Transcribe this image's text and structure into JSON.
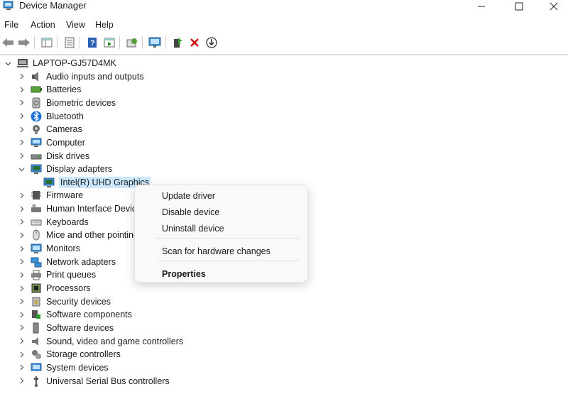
{
  "window": {
    "title": "Device Manager",
    "app_icon": "device-manager-icon",
    "controls": [
      "minimize-icon",
      "maximize-icon",
      "close-icon"
    ]
  },
  "menu": [
    "File",
    "Action",
    "View",
    "Help"
  ],
  "toolbar": [
    "back-arrow-icon",
    "forward-arrow-icon",
    "show-hide-tree-icon",
    "properties-icon",
    "help-icon",
    "action-pane-icon",
    "scan-changes-icon",
    "monitor-icon",
    "update-driver-icon",
    "uninstall-x-icon",
    "disable-device-icon"
  ],
  "tree": {
    "root": "LAPTOP-GJ57D4MK",
    "categories": [
      {
        "label": "Audio inputs and outputs",
        "icon": "speaker-icon"
      },
      {
        "label": "Batteries",
        "icon": "battery-icon"
      },
      {
        "label": "Biometric devices",
        "icon": "fingerprint-icon"
      },
      {
        "label": "Bluetooth",
        "icon": "bluetooth-icon"
      },
      {
        "label": "Cameras",
        "icon": "camera-icon"
      },
      {
        "label": "Computer",
        "icon": "computer-icon"
      },
      {
        "label": "Disk drives",
        "icon": "disk-drive-icon"
      },
      {
        "label": "Display adapters",
        "icon": "display-adapter-icon",
        "expanded": true,
        "children": [
          {
            "label": "Intel(R) UHD Graphics",
            "icon": "display-adapter-icon",
            "selected": true
          }
        ]
      },
      {
        "label": "Firmware",
        "icon": "firmware-icon"
      },
      {
        "label": "Human Interface Devices",
        "icon": "hid-icon"
      },
      {
        "label": "Keyboards",
        "icon": "keyboard-icon"
      },
      {
        "label": "Mice and other pointing devices",
        "icon": "mouse-icon"
      },
      {
        "label": "Monitors",
        "icon": "monitor-icon"
      },
      {
        "label": "Network adapters",
        "icon": "network-adapter-icon"
      },
      {
        "label": "Print queues",
        "icon": "printer-icon"
      },
      {
        "label": "Processors",
        "icon": "processor-icon"
      },
      {
        "label": "Security devices",
        "icon": "security-device-icon"
      },
      {
        "label": "Software components",
        "icon": "software-component-icon"
      },
      {
        "label": "Software devices",
        "icon": "software-device-icon"
      },
      {
        "label": "Sound, video and game controllers",
        "icon": "sound-controller-icon"
      },
      {
        "label": "Storage controllers",
        "icon": "storage-controller-icon"
      },
      {
        "label": "System devices",
        "icon": "system-device-icon"
      },
      {
        "label": "Universal Serial Bus controllers",
        "icon": "usb-icon"
      }
    ]
  },
  "context_menu": {
    "items": [
      "Update driver",
      "Disable device",
      "Uninstall device"
    ],
    "scan": "Scan for hardware changes",
    "properties": "Properties"
  },
  "colors": {
    "selection": "#cce8ff",
    "accent": "#0067c0",
    "uninstall": "#d01010"
  }
}
